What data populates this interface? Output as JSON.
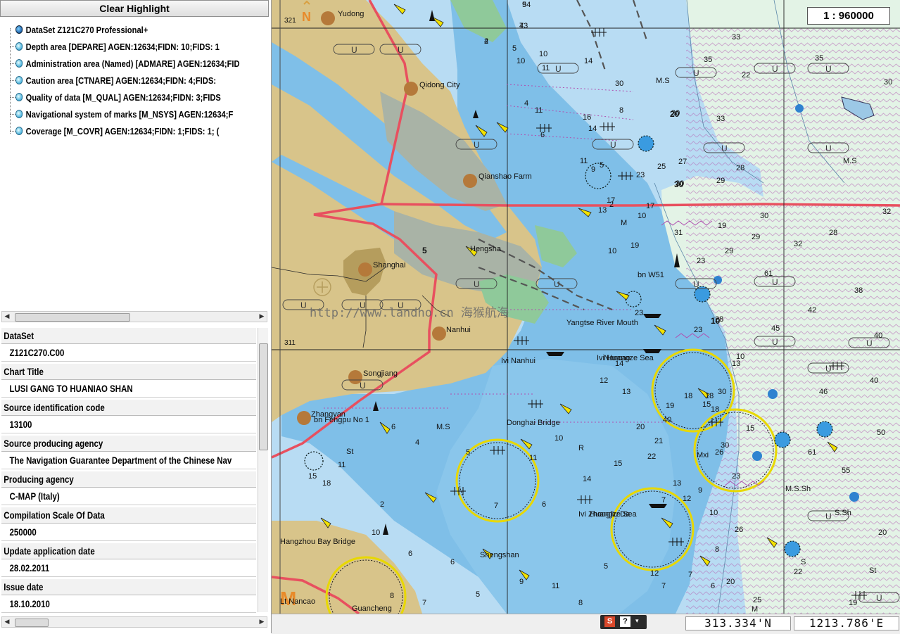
{
  "left_panel": {
    "clear_button": "Clear Highlight",
    "tree": [
      {
        "text": "DataSet Z121C270   Professional+",
        "icon": "globe-icon"
      },
      {
        "text": "Depth area [DEPARE]  AGEN:12634;FIDN:       10;FIDS:    1",
        "icon": "layer-icon"
      },
      {
        "text": "Administration area (Named) [ADMARE]  AGEN:12634;FID",
        "icon": "layer-icon"
      },
      {
        "text": "Caution area [CTNARE]  AGEN:12634;FIDN:       4;FIDS:",
        "icon": "layer-icon"
      },
      {
        "text": "Quality of data [M_QUAL]  AGEN:12634;FIDN:       3;FIDS",
        "icon": "layer-icon"
      },
      {
        "text": "Navigational system of marks [M_NSYS]  AGEN:12634;F",
        "icon": "layer-icon"
      },
      {
        "text": "Coverage [M_COVR]  AGEN:12634;FIDN:       1;FIDS:   1; (",
        "icon": "layer-icon"
      }
    ],
    "properties": [
      {
        "label": "DataSet",
        "value": "Z121C270.C00"
      },
      {
        "label": "Chart Title",
        "value": "LUSI GANG TO HUANIAO SHAN"
      },
      {
        "label": "Source identification code",
        "value": "13100"
      },
      {
        "label": "Source producing agency",
        "value": "The Navigation Guarantee Department of the Chinese Nav"
      },
      {
        "label": "Producing agency",
        "value": "C-MAP (Italy)"
      },
      {
        "label": "Compilation Scale Of Data",
        "value": "250000"
      },
      {
        "label": "Update application date",
        "value": "28.02.2011"
      },
      {
        "label": "Issue date",
        "value": "18.10.2010"
      }
    ]
  },
  "map": {
    "scale": "1 : 960000",
    "watermark": "http://www.landho.cn 海猴航海",
    "lat_labels": [
      "321",
      "311"
    ],
    "places": [
      "Yudong",
      "Qidong City",
      "Qianshao Farm",
      "Hengsha",
      "Shanghai",
      "Nanhui",
      "Songjiang",
      "Zhangyan",
      "Hangzhou Bay Bridge",
      "Guancheng",
      "Yangtse River Mouth",
      "Donghai Bridge",
      "Nancao",
      "Huangze Sea",
      "Shengshan"
    ],
    "misc_labels": [
      "bn Fengpu No 1",
      "Ivi Nanhui",
      "bn W51",
      "M.S",
      "M.S",
      "M.S",
      "M.S.Sh",
      "S.Sh",
      "S",
      "St",
      "St",
      "R",
      "M",
      "M",
      "Mxi",
      "Lt Nancao",
      "Ivi Huangze Sea",
      "Ivi Zhongliu Da"
    ],
    "sea_zones": [
      "U",
      "U",
      "U",
      "U",
      "U",
      "U",
      "U",
      "U",
      "U",
      "U",
      "U",
      "U",
      "U",
      "U",
      "U",
      "U",
      "U",
      "U",
      "U",
      "U",
      "U",
      "U",
      "U"
    ],
    "soundings": [
      "9",
      "7",
      "2",
      "5",
      "10",
      "10",
      "11",
      "14",
      "16",
      "8",
      "4",
      "11",
      "6",
      "14",
      "11",
      "5",
      "23",
      "2",
      "9",
      "17",
      "13",
      "30",
      "30",
      "25",
      "33",
      "33",
      "35",
      "35",
      "22",
      "28",
      "29",
      "27",
      "29",
      "23",
      "17",
      "10",
      "30",
      "19",
      "29",
      "28",
      "30",
      "30",
      "32",
      "32",
      "38",
      "40",
      "40",
      "42",
      "45",
      "46",
      "50",
      "55",
      "61",
      "61",
      "28",
      "31",
      "10",
      "19",
      "23",
      "14",
      "12",
      "13",
      "18",
      "18",
      "18",
      "19",
      "20",
      "21",
      "22",
      "15",
      "14",
      "10",
      "11",
      "6",
      "7",
      "5",
      "4",
      "6",
      "2",
      "11",
      "18",
      "15",
      "10",
      "6",
      "8",
      "7",
      "6",
      "5",
      "9",
      "11",
      "8",
      "5",
      "12",
      "7",
      "7",
      "6",
      "8",
      "10",
      "9",
      "12",
      "13",
      "7",
      "15",
      "13",
      "10",
      "30",
      "26",
      "23",
      "26",
      "25",
      "22",
      "19",
      "15",
      "30",
      "20",
      "20",
      "23",
      "40",
      "54",
      "43",
      "4"
    ],
    "depth_contours": [
      "10",
      "20",
      "30",
      "5"
    ]
  },
  "status": {
    "lat": "313.334'N",
    "lon": "1213.786'E"
  },
  "colors": {
    "land": "#d8c48a",
    "deep_sea": "#b8dcf3",
    "shallow_sea": "#7fbfe8",
    "very_shallow": "#5aa8dc",
    "green_tidal": "#8fc99a",
    "offshore_green": "#e3f3e6",
    "boundary_red": "#e8505f",
    "traffic_purple": "#b04fb0",
    "intertidal_grey": "#a9b3a6"
  }
}
